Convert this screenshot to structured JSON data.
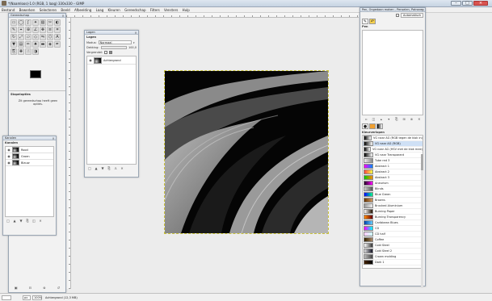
{
  "window": {
    "title": "*(Naamloos)-1.0 (RGB, 1 laag) 330x330 – GIMP"
  },
  "menubar": {
    "items": [
      "Bestand",
      "Bewerken",
      "Selecteren",
      "Beeld",
      "Afbeelding",
      "Laag",
      "Kleuren",
      "Gereedschap",
      "Filters",
      "Vensters",
      "Hulp"
    ]
  },
  "toolbox": {
    "title": "Gereedschap",
    "options_title": "Stapelopties",
    "options_msg": "Zit gereedschap heeft geen opties."
  },
  "layers": {
    "title": "Lagen",
    "heading": "Lagen",
    "mode_label": "Modus:",
    "mode_value": "Normaal",
    "opacity_label": "Dekking:",
    "opacity_value": "100,0",
    "lock_label": "Vergrendel:",
    "layer_name": "Achtergrond"
  },
  "channels": {
    "title": "Kanalen",
    "heading": "Kanalen",
    "items": [
      "Rood",
      "Groen",
      "Blauw"
    ]
  },
  "right_dock": {
    "title": "Pen, Ongedaan maken - Penselen, Patronen",
    "panel_tab": "Pen",
    "auto_btn": "Automatisch",
    "brushes_heading": "Kleurverlopen",
    "gradients": [
      {
        "name": "VG naar AG (RGB tegen de klok in)",
        "colors": [
          "#000",
          "#fff"
        ]
      },
      {
        "name": "VG naar AG (RGB)",
        "colors": [
          "#000",
          "#fff"
        ]
      },
      {
        "name": "VG naar AG (HSV met de klok mee)",
        "colors": [
          "#000",
          "#fff"
        ]
      },
      {
        "name": "VG naar Transparant",
        "colors": [
          "#000",
          "#fff0"
        ]
      },
      {
        "name": "Tube red 3",
        "colors": [
          "#eee",
          "#888"
        ]
      },
      {
        "name": "Abstract 1",
        "colors": [
          "#f0f",
          "#08f"
        ]
      },
      {
        "name": "Abstract 2",
        "colors": [
          "#f44",
          "#ff4"
        ]
      },
      {
        "name": "Abstract 3",
        "colors": [
          "#0c0",
          "#f80"
        ]
      },
      {
        "name": "Aneurism",
        "colors": [
          "#202",
          "#f0f"
        ]
      },
      {
        "name": "Blinds",
        "colors": [
          "#ccc",
          "#555"
        ]
      },
      {
        "name": "Blue Green",
        "colors": [
          "#00f",
          "#0f8"
        ]
      },
      {
        "name": "Browns",
        "colors": [
          "#630",
          "#c96"
        ]
      },
      {
        "name": "Brushed Aluminium",
        "colors": [
          "#999",
          "#eee"
        ]
      },
      {
        "name": "Burning Paper",
        "colors": [
          "#fff",
          "#210"
        ]
      },
      {
        "name": "Burning Transparency",
        "colors": [
          "#f80",
          "#600"
        ]
      },
      {
        "name": "Caribbean Blues",
        "colors": [
          "#04a",
          "#6cf"
        ]
      },
      {
        "name": "CD",
        "colors": [
          "#f0f",
          "#0ff"
        ]
      },
      {
        "name": "CD half",
        "colors": [
          "#fcf",
          "#cff"
        ]
      },
      {
        "name": "Coffee",
        "colors": [
          "#320",
          "#a86"
        ]
      },
      {
        "name": "Cold Steel",
        "colors": [
          "#fff",
          "#333"
        ]
      },
      {
        "name": "Cold Steel 2",
        "colors": [
          "#ddd",
          "#112"
        ]
      },
      {
        "name": "Crown molding",
        "colors": [
          "#bbb",
          "#444"
        ]
      },
      {
        "name": "Dark 1",
        "colors": [
          "#420",
          "#000"
        ]
      }
    ],
    "selected_gradient_index": 1
  },
  "statusbar": {
    "unit": "px",
    "zoom": "100%",
    "info": "Achtergrond (12,3 MB)"
  }
}
